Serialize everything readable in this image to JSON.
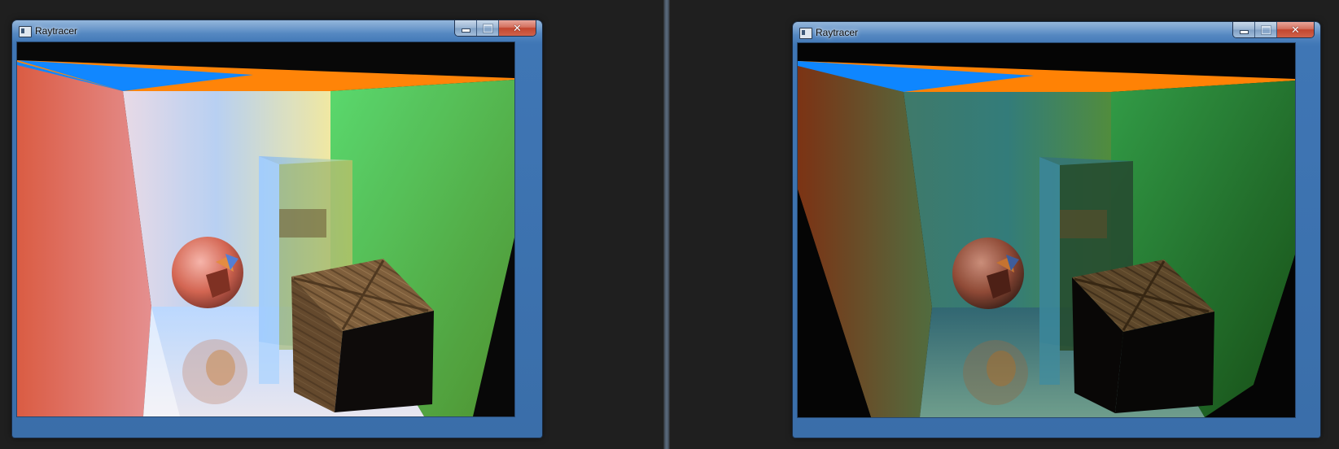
{
  "windows": [
    {
      "title": "Raytracer",
      "render": "full-lighting"
    },
    {
      "title": "Raytracer",
      "render": "indirect-lighting"
    }
  ],
  "colors": {
    "desktop": "#1f1f1f",
    "titlebar": "#4c83c0",
    "close_button": "#c94a33",
    "left_wall": "#d8564a",
    "right_wall": "#6fcf3d",
    "ceiling_orange": "#ff7f00",
    "ceiling_blue": "#0080ff",
    "back_wall": "#d8dde9"
  },
  "icons": {
    "app": "window-app-icon",
    "minimize": "minimize-icon",
    "maximize": "maximize-icon",
    "close": "close-icon"
  }
}
